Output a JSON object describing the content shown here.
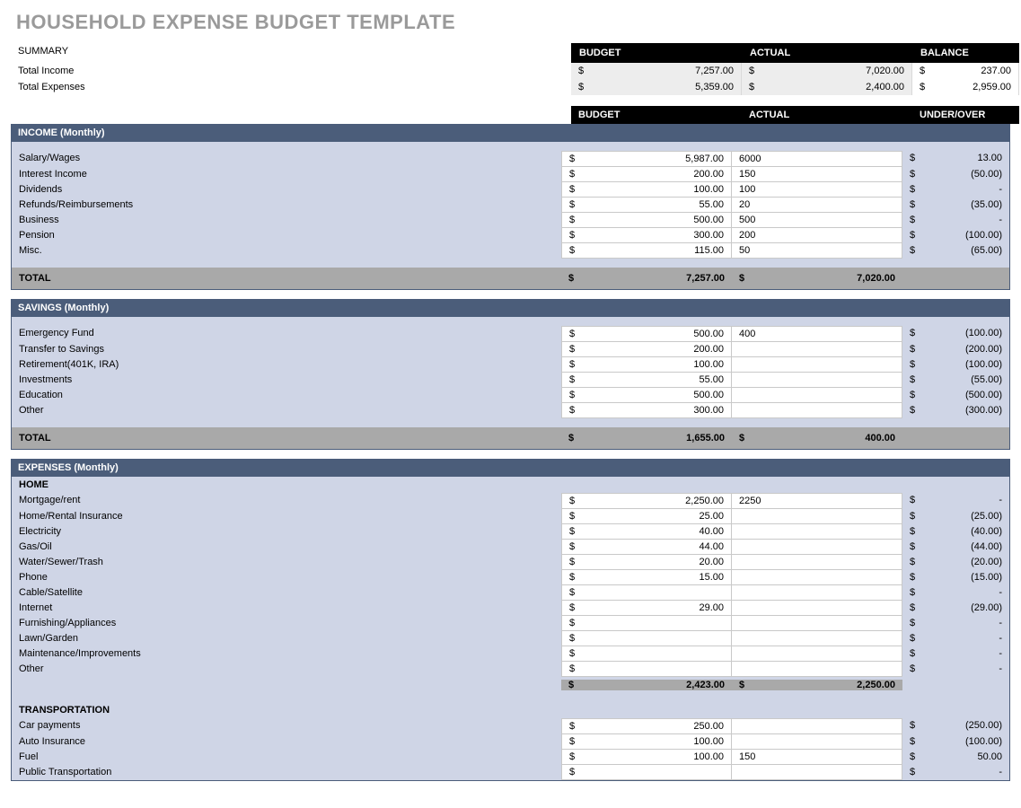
{
  "page_title": "HOUSEHOLD EXPENSE BUDGET TEMPLATE",
  "summary": {
    "title": "SUMMARY",
    "col_budget": "BUDGET",
    "col_actual": "ACTUAL",
    "col_balance": "BALANCE",
    "rows": [
      {
        "label": "Total Income",
        "budget": "7,257.00",
        "actual": "7,020.00",
        "balance": "237.00"
      },
      {
        "label": "Total Expenses",
        "budget": "5,359.00",
        "actual": "2,400.00",
        "balance": "2,959.00"
      }
    ]
  },
  "section_cols": {
    "budget": "BUDGET",
    "actual": "ACTUAL",
    "diff": "UNDER/OVER"
  },
  "income": {
    "title": "INCOME (Monthly)",
    "rows": [
      {
        "label": "Salary/Wages",
        "budget": "5,987.00",
        "actual": "6000",
        "diff": "13.00"
      },
      {
        "label": "Interest Income",
        "budget": "200.00",
        "actual": "150",
        "diff": "(50.00)"
      },
      {
        "label": "Dividends",
        "budget": "100.00",
        "actual": "100",
        "diff": "-"
      },
      {
        "label": "Refunds/Reimbursements",
        "budget": "55.00",
        "actual": "20",
        "diff": "(35.00)"
      },
      {
        "label": "Business",
        "budget": "500.00",
        "actual": "500",
        "diff": "-"
      },
      {
        "label": "Pension",
        "budget": "300.00",
        "actual": "200",
        "diff": "(100.00)"
      },
      {
        "label": "Misc.",
        "budget": "115.00",
        "actual": "50",
        "diff": "(65.00)"
      }
    ],
    "total_label": "TOTAL",
    "total_budget": "7,257.00",
    "total_actual": "7,020.00"
  },
  "savings": {
    "title": "SAVINGS (Monthly)",
    "rows": [
      {
        "label": "Emergency Fund",
        "budget": "500.00",
        "actual": "400",
        "diff": "(100.00)"
      },
      {
        "label": "Transfer to Savings",
        "budget": "200.00",
        "actual": "",
        "diff": "(200.00)"
      },
      {
        "label": "Retirement(401K, IRA)",
        "budget": "100.00",
        "actual": "",
        "diff": "(100.00)"
      },
      {
        "label": "Investments",
        "budget": "55.00",
        "actual": "",
        "diff": "(55.00)"
      },
      {
        "label": "Education",
        "budget": "500.00",
        "actual": "",
        "diff": "(500.00)"
      },
      {
        "label": "Other",
        "budget": "300.00",
        "actual": "",
        "diff": "(300.00)"
      }
    ],
    "total_label": "TOTAL",
    "total_budget": "1,655.00",
    "total_actual": "400.00"
  },
  "expenses": {
    "title": "EXPENSES (Monthly)",
    "home": {
      "title": "HOME",
      "rows": [
        {
          "label": "Mortgage/rent",
          "budget": "2,250.00",
          "actual": "2250",
          "diff": "-"
        },
        {
          "label": "Home/Rental Insurance",
          "budget": "25.00",
          "actual": "",
          "diff": "(25.00)"
        },
        {
          "label": "Electricity",
          "budget": "40.00",
          "actual": "",
          "diff": "(40.00)"
        },
        {
          "label": "Gas/Oil",
          "budget": "44.00",
          "actual": "",
          "diff": "(44.00)"
        },
        {
          "label": "Water/Sewer/Trash",
          "budget": "20.00",
          "actual": "",
          "diff": "(20.00)"
        },
        {
          "label": "Phone",
          "budget": "15.00",
          "actual": "",
          "diff": "(15.00)"
        },
        {
          "label": "Cable/Satellite",
          "budget": "",
          "actual": "",
          "diff": "-"
        },
        {
          "label": "Internet",
          "budget": "29.00",
          "actual": "",
          "diff": "(29.00)"
        },
        {
          "label": "Furnishing/Appliances",
          "budget": "",
          "actual": "",
          "diff": "-"
        },
        {
          "label": "Lawn/Garden",
          "budget": "",
          "actual": "",
          "diff": "-"
        },
        {
          "label": "Maintenance/Improvements",
          "budget": "",
          "actual": "",
          "diff": "-"
        },
        {
          "label": "Other",
          "budget": "",
          "actual": "",
          "diff": "-"
        }
      ],
      "subtotal_budget": "2,423.00",
      "subtotal_actual": "2,250.00"
    },
    "transport": {
      "title": "TRANSPORTATION",
      "rows": [
        {
          "label": "Car payments",
          "budget": "250.00",
          "actual": "",
          "diff": "(250.00)"
        },
        {
          "label": "Auto Insurance",
          "budget": "100.00",
          "actual": "",
          "diff": "(100.00)"
        },
        {
          "label": "Fuel",
          "budget": "100.00",
          "actual": "150",
          "diff": "50.00"
        },
        {
          "label": "Public Transportation",
          "budget": "",
          "actual": "",
          "diff": "-"
        }
      ]
    }
  }
}
